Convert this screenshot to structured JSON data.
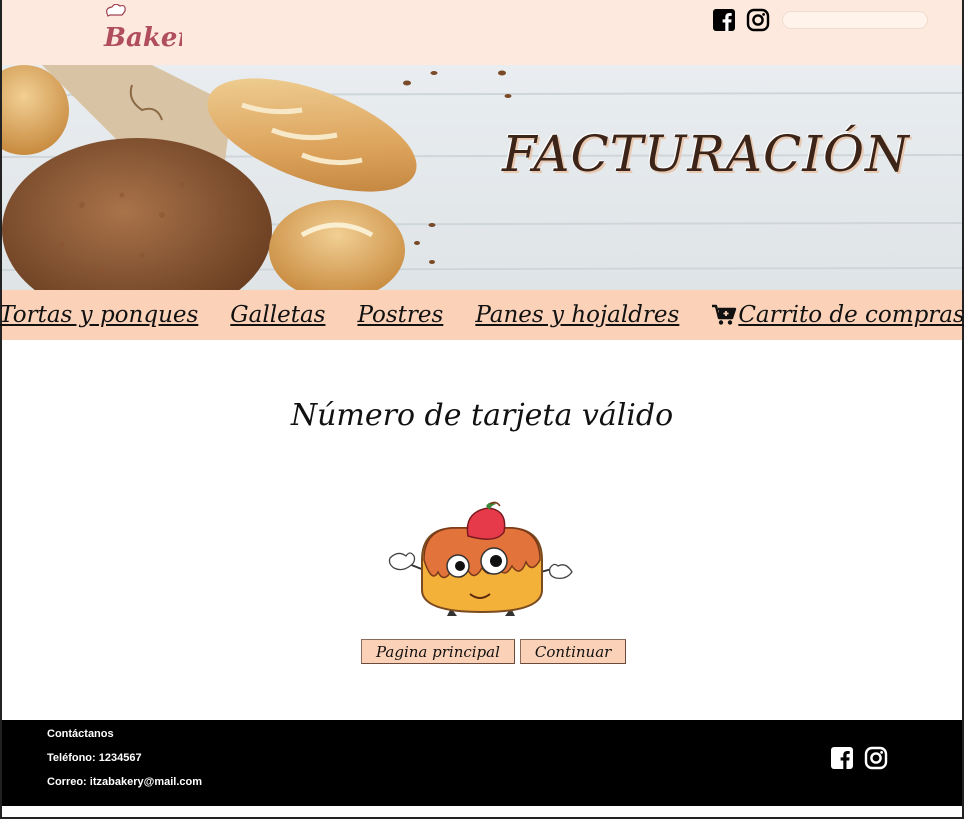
{
  "header": {
    "logo_text": "Bakery",
    "search": {
      "value": "",
      "placeholder": ""
    },
    "icons": [
      "facebook-icon",
      "instagram-icon"
    ]
  },
  "banner": {
    "title": "FACTURACIÓN"
  },
  "nav": {
    "items": [
      {
        "label": "Tortas y ponques"
      },
      {
        "label": "Galletas"
      },
      {
        "label": "Postres"
      },
      {
        "label": "Panes y hojaldres"
      },
      {
        "label": "Carrito de compras",
        "icon": "cart-icon"
      }
    ]
  },
  "main": {
    "heading": "Número de tarjeta válido",
    "buttons": {
      "home": "Pagina principal",
      "continue": "Continuar"
    }
  },
  "footer": {
    "contact_title": "Contáctanos",
    "phone": "Teléfono: 1234567",
    "email": "Correo: itzabakery@mail.com",
    "icons": [
      "facebook-icon",
      "instagram-icon"
    ]
  },
  "colors": {
    "topbar": "#fde9dd",
    "nav": "#fbd2b8",
    "button": "#fbd2b8",
    "footer": "#000000"
  }
}
